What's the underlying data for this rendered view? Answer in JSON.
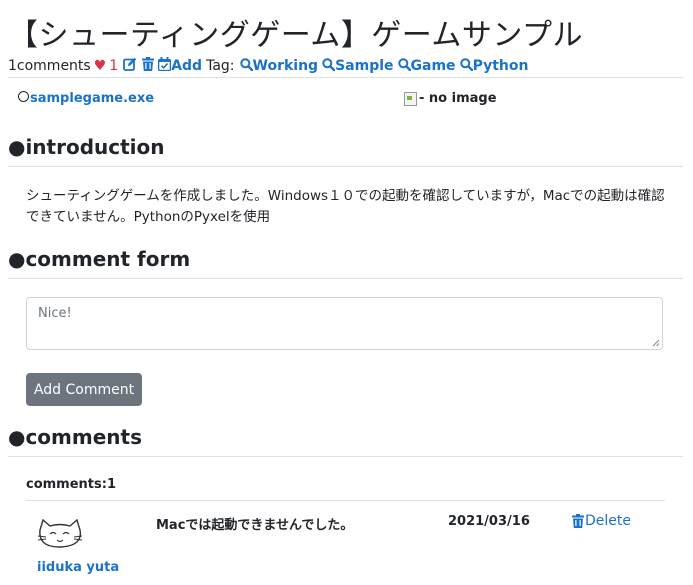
{
  "page": {
    "title": "【シューティングゲーム】ゲームサンプル"
  },
  "meta": {
    "comments_label": "1comments",
    "like_count": "1",
    "add_label": "Add",
    "tag_label": "Tag:",
    "tags": [
      "Working",
      "Sample",
      "Game",
      "Python"
    ]
  },
  "file": {
    "name": "samplegame.exe",
    "image_alt": "- no image"
  },
  "sections": {
    "introduction": "●introduction",
    "comment_form": "●comment form",
    "comments": "●comments"
  },
  "introduction": {
    "text": "シューティングゲームを作成しました。Windows１０での起動を確認していますが，Macでの起動は確認できていません。PythonのPyxelを使用"
  },
  "form": {
    "placeholder": "Nice!",
    "submit_label": "Add Comment"
  },
  "comments": {
    "count_label": "comments:1",
    "items": [
      {
        "user": "iiduka yuta",
        "text": "Macでは起動できませんでした。",
        "date": "2021/03/16",
        "delete_label": "Delete"
      }
    ]
  },
  "colors": {
    "link": "#1a73c8",
    "heart": "#d9344a",
    "button": "#6c757d"
  }
}
